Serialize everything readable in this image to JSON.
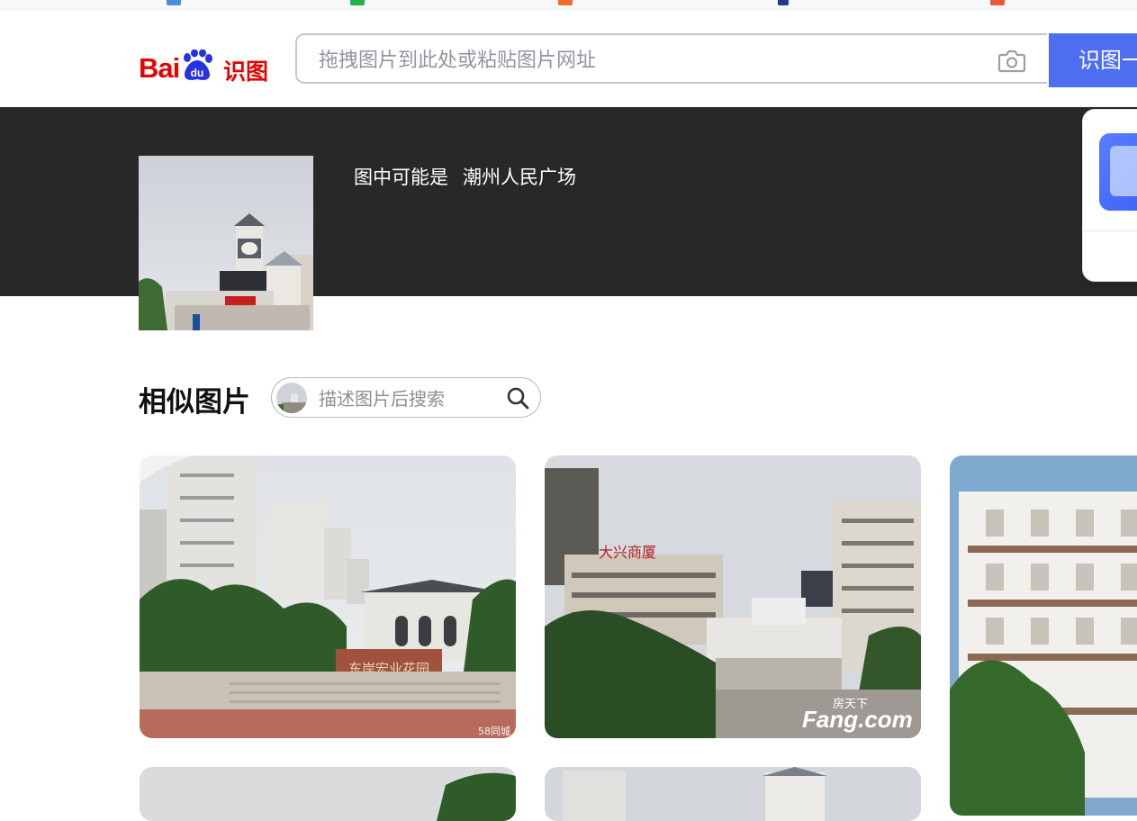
{
  "header": {
    "logo_bai": "Bai",
    "logo_shitu": "识图",
    "search_placeholder": "拖拽图片到此处或粘贴图片网址",
    "search_button": "识图一下"
  },
  "banner": {
    "guess_label": "图中可能是",
    "guess_value": "潮州人民广场"
  },
  "similar": {
    "title": "相似图片",
    "filter_placeholder": "描述图片后搜索"
  },
  "results": {
    "r1_watermark": "58同城",
    "r1_sign": "东岸宏业花园",
    "r2_sign": "大兴商厦",
    "r2_wm_cn": "房天下",
    "r2_wm": "Fang.com"
  },
  "colors": {
    "brand_red": "#e10601",
    "brand_blue": "#2932e1",
    "accent": "#4e6ef2",
    "banner_bg": "#282828"
  },
  "icons": [
    "camera-icon",
    "search-icon",
    "paw-icon"
  ]
}
